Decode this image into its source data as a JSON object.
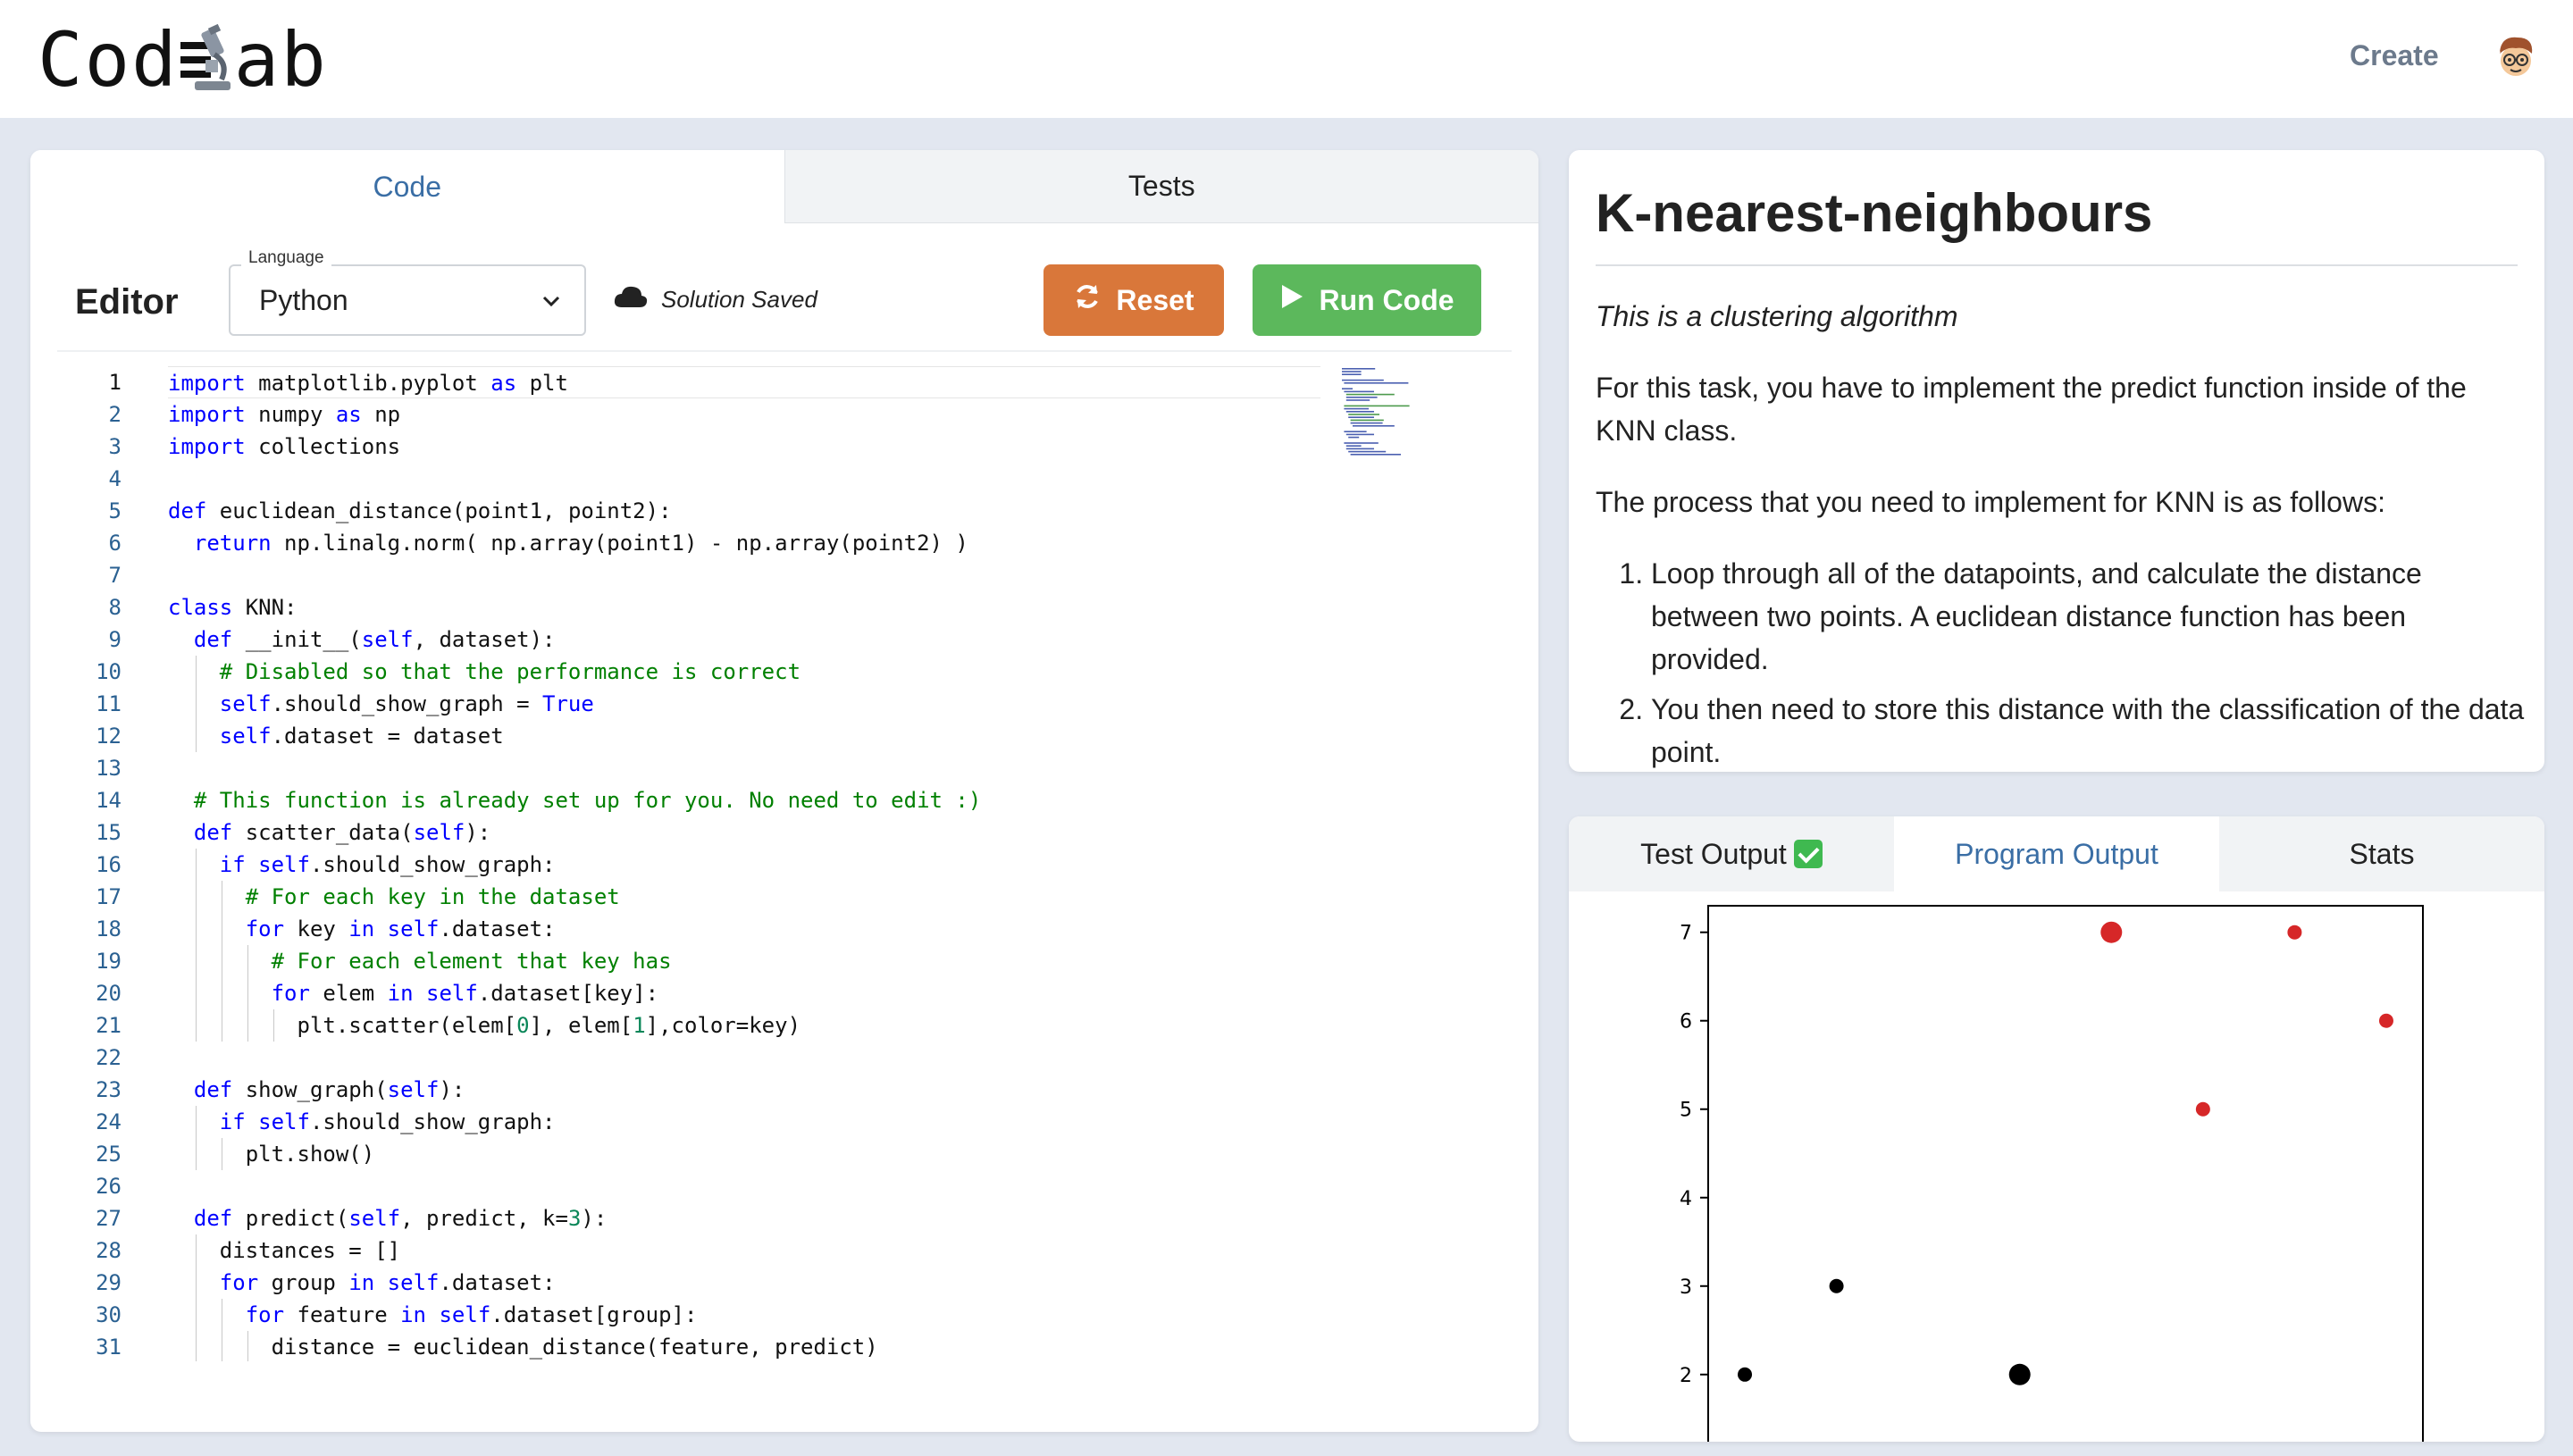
{
  "app": {
    "logo_text_left": "Cod",
    "logo_text_right": "ab",
    "create_label": "Create"
  },
  "editor": {
    "tabs": [
      "Code",
      "Tests"
    ],
    "active_tab": "Code",
    "title": "Editor",
    "language_label": "Language",
    "language_value": "Python",
    "save_status": "Solution Saved",
    "reset_label": "Reset",
    "run_label": "Run Code",
    "code_lines": [
      "import matplotlib.pyplot as plt",
      "import numpy as np",
      "import collections",
      "",
      "def euclidean_distance(point1, point2):",
      "  return np.linalg.norm( np.array(point1) - np.array(point2) )",
      "",
      "class KNN:",
      "  def __init__(self, dataset):",
      "    # Disabled so that the performance is correct",
      "    self.should_show_graph = True",
      "    self.dataset = dataset",
      "",
      "  # This function is already set up for you. No need to edit :)",
      "  def scatter_data(self):",
      "    if self.should_show_graph:",
      "      # For each key in the dataset",
      "      for key in self.dataset:",
      "        # For each element that key has",
      "        for elem in self.dataset[key]:",
      "          plt.scatter(elem[0], elem[1],color=key)",
      "",
      "  def show_graph(self):",
      "    if self.should_show_graph:",
      "      plt.show()",
      "",
      "  def predict(self, predict, k=3):",
      "    distances = []",
      "    for group in self.dataset:",
      "      for feature in self.dataset[group]:",
      "        distance = euclidean_distance(feature, predict)"
    ]
  },
  "description": {
    "title": "K-nearest-neighbours",
    "intro": "This is a clustering algorithm",
    "paragraph1": "For this task, you have to implement the predict function inside of the KNN class.",
    "paragraph2": "The process that you need to implement for KNN is as follows:",
    "steps": [
      "Loop through all of the datapoints, and calculate the distance between two points. A euclidean distance function has been provided.",
      "You then need to store this distance with the classification of the data point."
    ]
  },
  "output": {
    "tabs": [
      "Test Output",
      "Program Output",
      "Stats"
    ],
    "active_tab": "Program Output",
    "test_status_icon": "check-icon"
  },
  "chart_data": {
    "type": "scatter",
    "title": "",
    "xlabel": "",
    "ylabel": "",
    "y_ticks": [
      "2",
      "3",
      "4",
      "5",
      "6",
      "7"
    ],
    "ylim": [
      1.2,
      7.3
    ],
    "xlim": [
      0.6,
      8.4
    ],
    "grid": false,
    "series": [
      {
        "color": "#000000",
        "points": [
          {
            "x": 1,
            "y": 2
          },
          {
            "x": 2,
            "y": 3
          },
          {
            "x": 4,
            "y": 2,
            "big": true
          }
        ]
      },
      {
        "color": "#d62728",
        "points": [
          {
            "x": 5,
            "y": 7,
            "big": true
          },
          {
            "x": 6,
            "y": 5
          },
          {
            "x": 7,
            "y": 7
          },
          {
            "x": 8,
            "y": 6
          }
        ]
      }
    ]
  }
}
